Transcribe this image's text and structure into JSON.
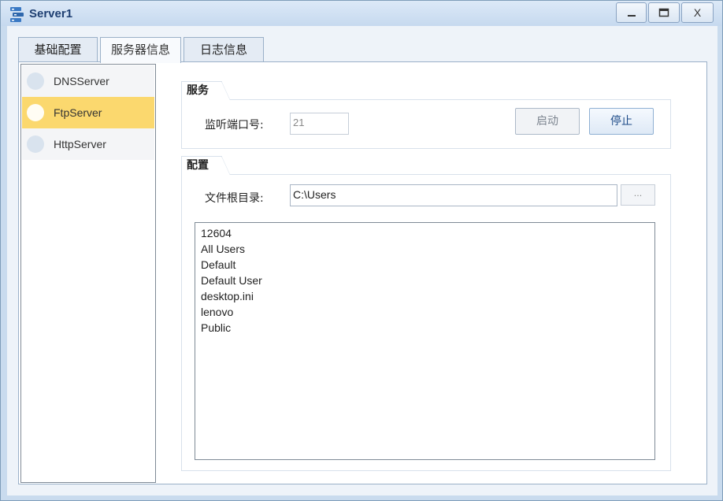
{
  "window": {
    "title": "Server1",
    "minimize_label": "",
    "maximize_label": "",
    "close_label": "X"
  },
  "tabs": [
    {
      "label": "基础配置",
      "active": false
    },
    {
      "label": "服务器信息",
      "active": true
    },
    {
      "label": "日志信息",
      "active": false
    }
  ],
  "servers": [
    {
      "label": "DNSServer",
      "selected": false
    },
    {
      "label": "FtpServer",
      "selected": true
    },
    {
      "label": "HttpServer",
      "selected": false
    }
  ],
  "service": {
    "group_title": "服务",
    "port_label": "监听端口号:",
    "port_value": "21",
    "start_label": "启动",
    "stop_label": "停止"
  },
  "config": {
    "group_title": "配置",
    "root_label": "文件根目录:",
    "root_value": "C:\\Users",
    "browse_label": "...",
    "files": [
      "12604",
      "All Users",
      "Default",
      "Default User",
      "desktop.ini",
      "lenovo",
      "Public"
    ]
  },
  "colors": {
    "selected_item": "#fbd86e",
    "title_text": "#1e3f72",
    "window_frame": "#c9dbee"
  }
}
